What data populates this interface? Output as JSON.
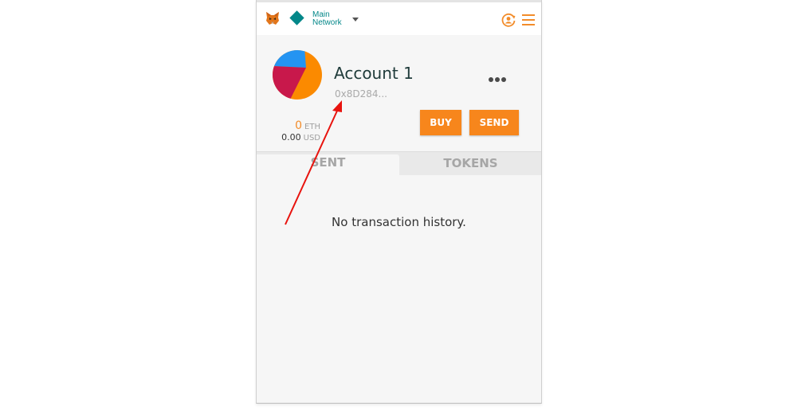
{
  "network": {
    "line1": "Main",
    "line2": "Network"
  },
  "account": {
    "name": "Account 1",
    "address": "0x8D284..."
  },
  "balance": {
    "eth_value": "0",
    "eth_unit": "ETH",
    "usd_value": "0.00",
    "usd_unit": "USD"
  },
  "actions": {
    "buy_label": "BUY",
    "send_label": "SEND"
  },
  "tabs": [
    {
      "label": "SENT",
      "active": true
    },
    {
      "label": "TOKENS",
      "active": false
    }
  ],
  "history": {
    "empty_message": "No transaction history."
  },
  "icons": {
    "logo": "metamask-fox-icon",
    "network": "network-diamond-icon",
    "account_switch": "account-switch-icon",
    "menu": "hamburger-menu-icon",
    "more": "more-options-icon",
    "caret": "caret-down-icon"
  },
  "colors": {
    "accent": "#f7861c",
    "network": "#038789",
    "annotation_arrow": "#e8130e",
    "avatar_blue": "#2494f2",
    "avatar_orange": "#fb8a00",
    "avatar_red": "#c8184b"
  }
}
